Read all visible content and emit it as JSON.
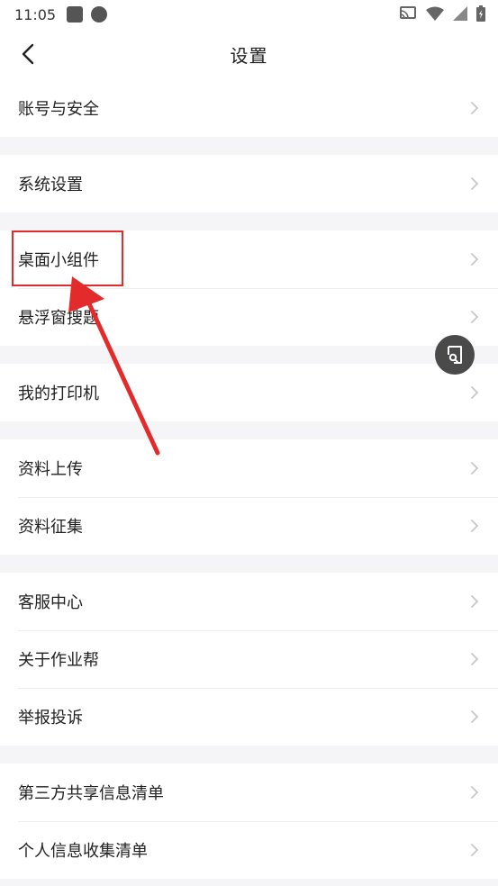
{
  "status_bar": {
    "time": "11:05"
  },
  "nav": {
    "title": "设置"
  },
  "groups": [
    [
      "账号与安全"
    ],
    [
      "系统设置"
    ],
    [
      "桌面小组件",
      "悬浮窗搜题"
    ],
    [
      "我的打印机"
    ],
    [
      "资料上传",
      "资料征集"
    ],
    [
      "客服中心",
      "关于作业帮",
      "举报投诉"
    ],
    [
      "第三方共享信息清单",
      "个人信息收集清单"
    ]
  ],
  "colors": {
    "highlight": "#e32b2b",
    "background": "#f5f5f7"
  }
}
